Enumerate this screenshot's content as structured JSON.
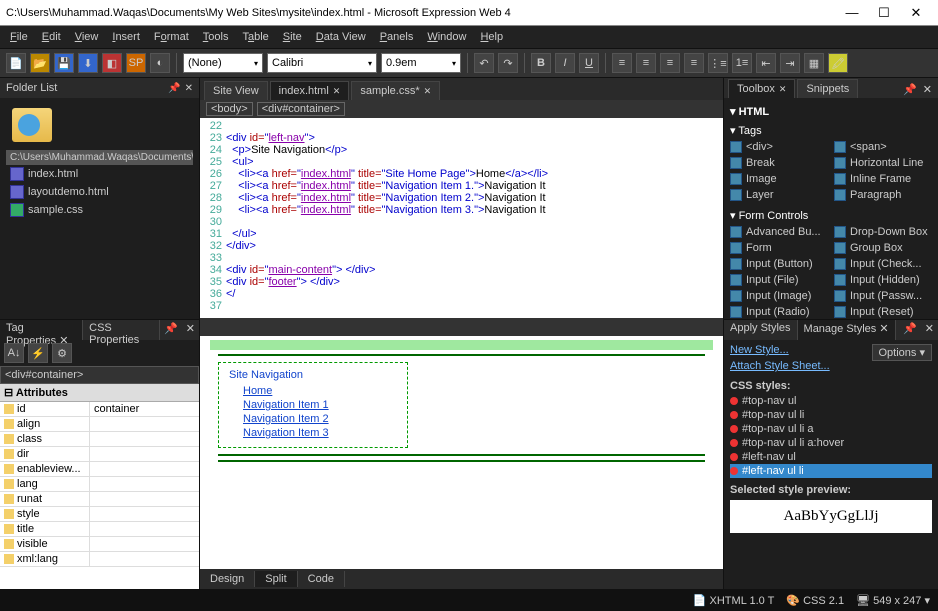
{
  "window": {
    "title": "C:\\Users\\Muhammad.Waqas\\Documents\\My Web Sites\\mysite\\index.html - Microsoft Expression Web 4"
  },
  "menu": [
    "File",
    "Edit",
    "View",
    "Insert",
    "Format",
    "Tools",
    "Table",
    "Site",
    "Data View",
    "Panels",
    "Window",
    "Help"
  ],
  "toolbar": {
    "style_sel": "(None)",
    "font_sel": "Calibri",
    "size_sel": "0.9em"
  },
  "folder": {
    "title": "Folder List",
    "path": "C:\\Users\\Muhammad.Waqas\\Documents\\M",
    "files": [
      "index.html",
      "layoutdemo.html",
      "sample.css"
    ]
  },
  "tag_panel": {
    "tabs": [
      "Tag Properties",
      "CSS Properties"
    ],
    "selector": "<div#container>",
    "hdr": "Attributes",
    "rows": [
      [
        "id",
        "container"
      ],
      [
        "align",
        ""
      ],
      [
        "class",
        ""
      ],
      [
        "dir",
        ""
      ],
      [
        "enableview...",
        ""
      ],
      [
        "lang",
        ""
      ],
      [
        "runat",
        ""
      ],
      [
        "style",
        ""
      ],
      [
        "title",
        ""
      ],
      [
        "visible",
        ""
      ],
      [
        "xml:lang",
        ""
      ]
    ]
  },
  "editor": {
    "tabs": [
      "Site View",
      "index.html",
      "sample.css*"
    ],
    "active": 1,
    "crumbs": [
      "<body>",
      "<div#container>"
    ],
    "lines": [
      22,
      23,
      24,
      25,
      26,
      27,
      28,
      29,
      30,
      31,
      32,
      33,
      34,
      35,
      36,
      37
    ],
    "view_tabs": [
      "Design",
      "Split",
      "Code"
    ],
    "active_view": 1
  },
  "code": {
    "l23": "<div id=\"left-nav\">",
    "l24": "  <p>Site Navigation</p>",
    "l25": "  <ul>",
    "l26": "    <li><a href=\"index.html\" title=\"Site Home Page\">Home</a></li>",
    "l27": "    <li><a href=\"index.html\" title=\"Navigation Item 1.\">Navigation It",
    "l28": "    <li><a href=\"index.html\" title=\"Navigation Item 2.\">Navigation It",
    "l29": "    <li><a href=\"index.html\" title=\"Navigation Item 3.\">Navigation It",
    "l30": "",
    "l31": "  </ul>",
    "l32": "</div>",
    "l34": "<div id=\"main-content\"> </div>",
    "l35": "<div id=\"footer\"> </div>",
    "l36": "</"
  },
  "preview": {
    "heading": "Site Navigation",
    "links": [
      "Home",
      "Navigation Item 1",
      "Navigation Item 2",
      "Navigation Item 3"
    ]
  },
  "toolbox": {
    "tabs": [
      "Toolbox",
      "Snippets"
    ],
    "title": "HTML",
    "sec1": "Tags",
    "sec2": "Form Controls",
    "tags": [
      "<div>",
      "<span>",
      "Break",
      "Horizontal Line",
      "Image",
      "Inline Frame",
      "Layer",
      "Paragraph"
    ],
    "forms": [
      "Advanced Bu...",
      "Drop-Down Box",
      "Form",
      "Group Box",
      "Input (Button)",
      "Input (Check...",
      "Input (File)",
      "Input (Hidden)",
      "Input (Image)",
      "Input (Passw...",
      "Input (Radio)",
      "Input (Reset)"
    ]
  },
  "styles": {
    "tabs": [
      "Apply Styles",
      "Manage Styles"
    ],
    "new": "New Style...",
    "attach": "Attach Style Sheet...",
    "opts": "Options",
    "lbl": "CSS styles:",
    "items": [
      "#top-nav ul",
      "#top-nav ul li",
      "#top-nav ul li a",
      "#top-nav ul li a:hover",
      "#left-nav ul",
      "#left-nav ul li"
    ],
    "sel": 5,
    "preview_lbl": "Selected style preview:",
    "preview": "AaBbYyGgLlJj"
  },
  "status": {
    "xhtml": "XHTML 1.0 T",
    "css": "CSS 2.1",
    "size": "549 x 247"
  }
}
